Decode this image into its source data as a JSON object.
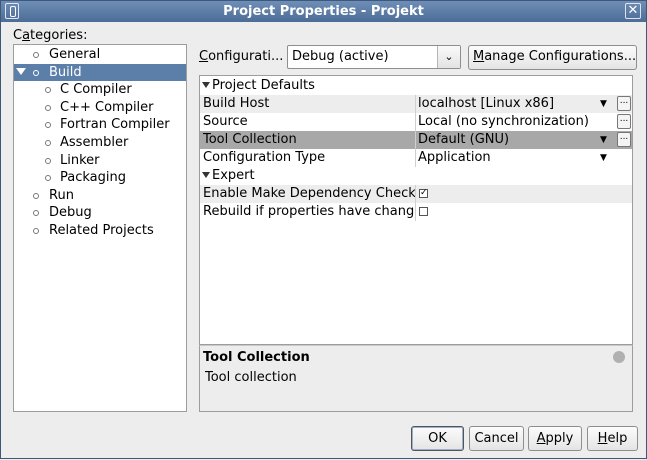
{
  "window": {
    "title": "Project Properties - Projekt",
    "close_glyph": "✕"
  },
  "categories": {
    "label_pre": "C",
    "label_mnemonic": "a",
    "label_post": "tegories:",
    "items": [
      {
        "label": "General",
        "level": 0
      },
      {
        "label": "Build",
        "level": 0,
        "expanded": true,
        "selected": true
      },
      {
        "label": "C Compiler",
        "level": 1
      },
      {
        "label": "C++ Compiler",
        "level": 1
      },
      {
        "label": "Fortran Compiler",
        "level": 1
      },
      {
        "label": "Assembler",
        "level": 1
      },
      {
        "label": "Linker",
        "level": 1
      },
      {
        "label": "Packaging",
        "level": 1
      },
      {
        "label": "Run",
        "level": 0
      },
      {
        "label": "Debug",
        "level": 0
      },
      {
        "label": "Related Projects",
        "level": 0
      }
    ]
  },
  "configuration": {
    "label_mnemonic": "C",
    "label_rest": "onfigurati...",
    "selected": "Debug (active)",
    "arrow_glyph": "⌄",
    "manage_mnemonic": "M",
    "manage_rest": "anage Configurations..."
  },
  "properties": {
    "sections": [
      {
        "title": "Project Defaults",
        "rows": [
          {
            "key": "Build Host",
            "value": "localhost [Linux x86]",
            "dropdown": true,
            "ellipsis": true
          },
          {
            "key": "Source",
            "value": "Local (no synchronization)",
            "ellipsis": true
          },
          {
            "key": "Tool Collection",
            "value": "Default (GNU)",
            "dropdown": true,
            "ellipsis": true,
            "selected": true
          },
          {
            "key": "Configuration Type",
            "value": "Application",
            "dropdown": true
          }
        ]
      },
      {
        "title": "Expert",
        "rows": [
          {
            "key": "Enable Make Dependency Checking",
            "checkbox": true,
            "checked": true
          },
          {
            "key": "Rebuild if properties have changed",
            "checkbox": true,
            "checked": false
          }
        ]
      }
    ],
    "ellipsis_glyph": "...",
    "dropdown_glyph": "▼",
    "check_glyph": "✓"
  },
  "description": {
    "title": "Tool Collection",
    "text": "Tool collection"
  },
  "buttons": {
    "ok": "OK",
    "cancel": "Cancel",
    "apply_mnemonic": "A",
    "apply_rest": "pply",
    "help_mnemonic": "H",
    "help_rest": "elp"
  }
}
